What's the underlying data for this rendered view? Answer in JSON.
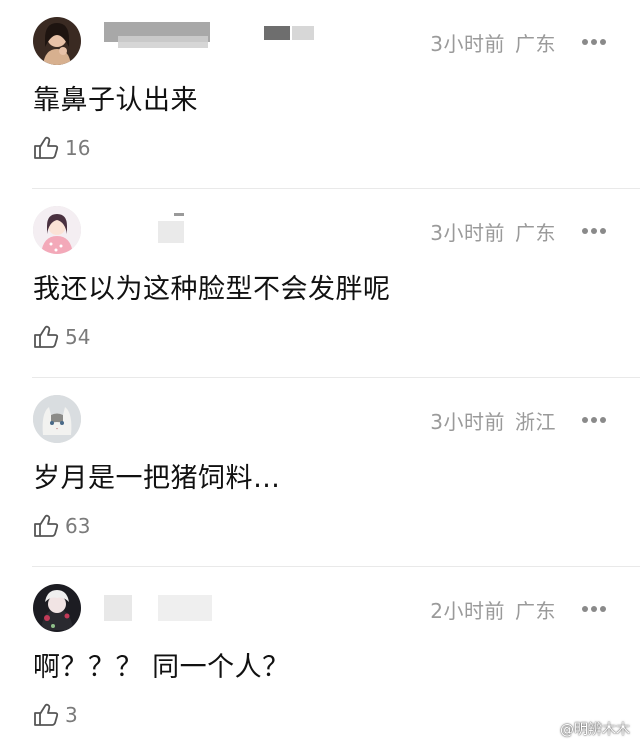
{
  "comments": [
    {
      "text": "靠鼻子认出来",
      "time": "3小时前",
      "region": "广东",
      "likes": "16",
      "avatar_icon": "woman-portrait-avatar"
    },
    {
      "text": "我还以为这种脸型不会发胖呢",
      "time": "3小时前",
      "region": "广东",
      "likes": "54",
      "avatar_icon": "cartoon-girl-avatar"
    },
    {
      "text": "岁月是一把猪饲料…",
      "time": "3小时前",
      "region": "浙江",
      "likes": "63",
      "avatar_icon": "cat-avatar"
    },
    {
      "text": "啊？？？ 同一个人？",
      "time": "2小时前",
      "region": "广东",
      "likes": "3",
      "avatar_icon": "anime-character-avatar"
    }
  ],
  "watermark": "@明辨木木",
  "colors": {
    "meta": "#9a9a9a",
    "text": "#111111",
    "divider": "#e9e9e9"
  }
}
